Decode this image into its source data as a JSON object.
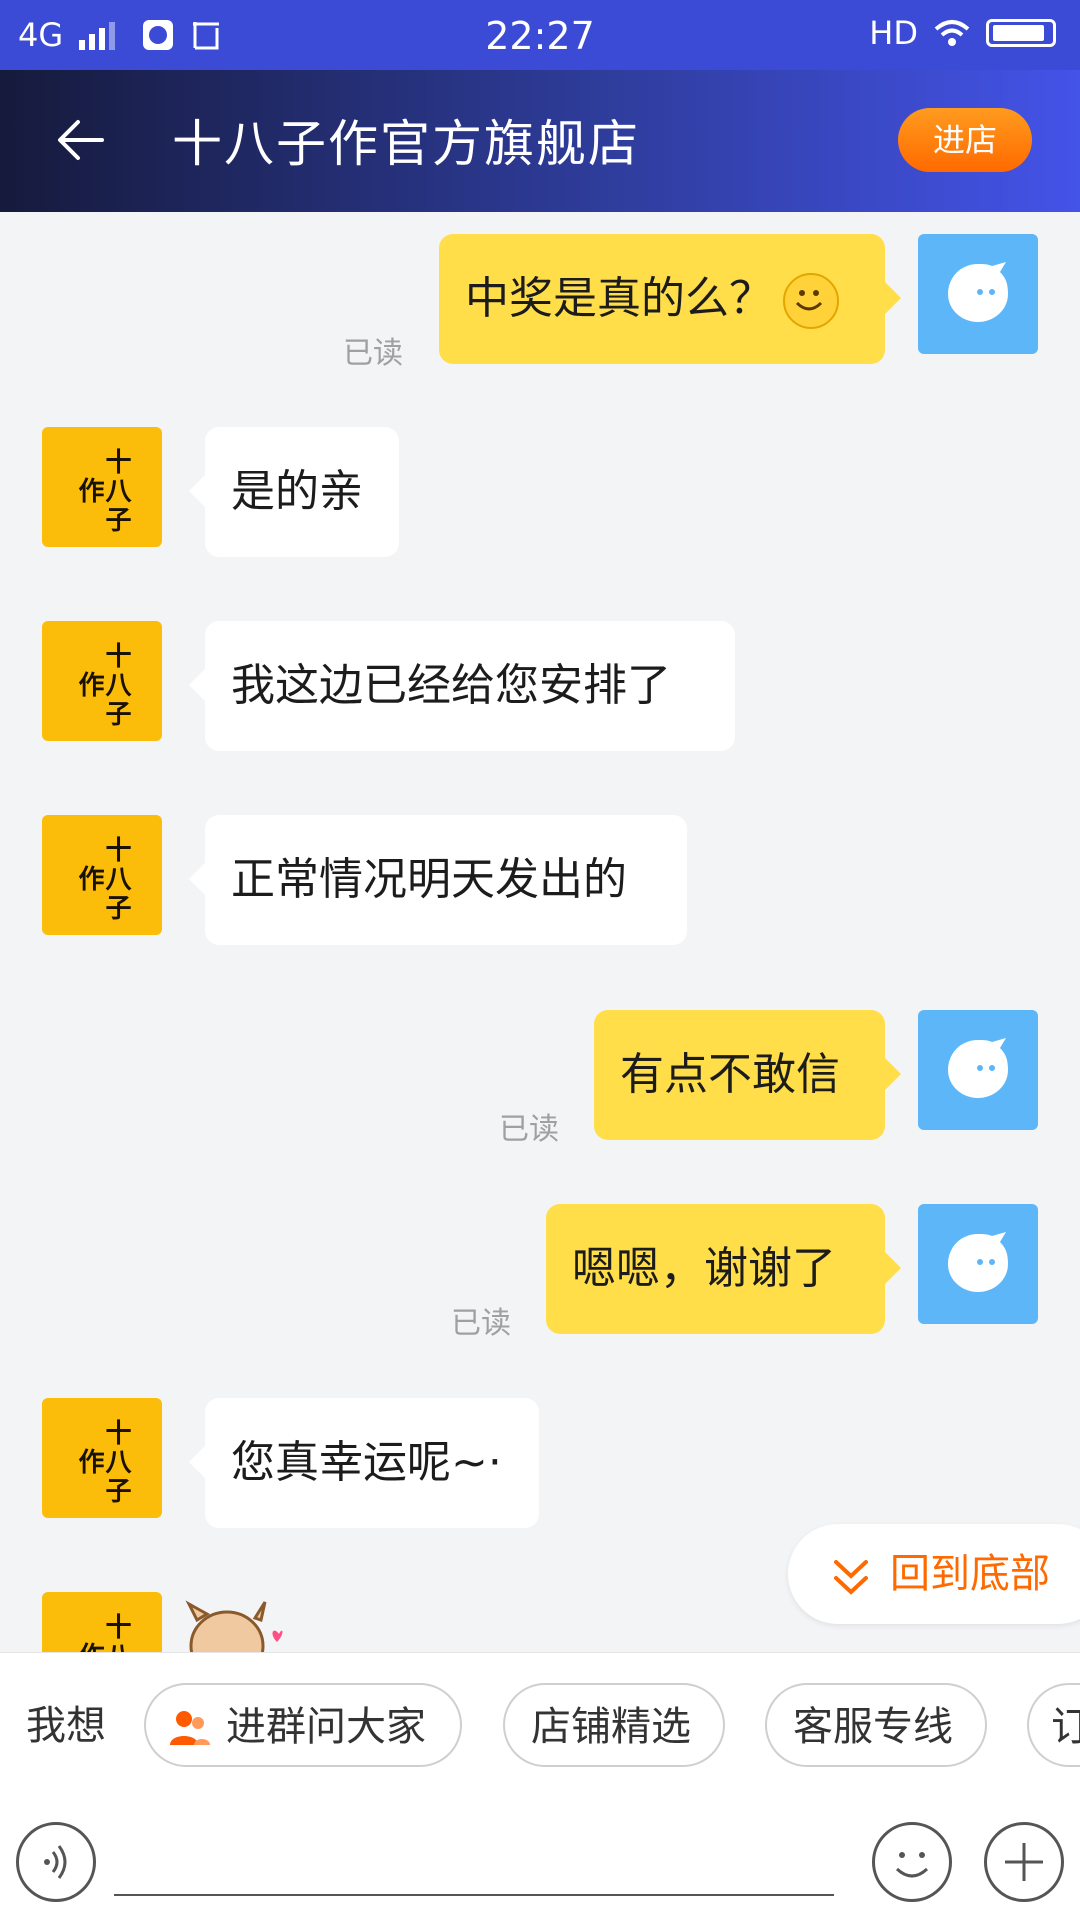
{
  "status_bar": {
    "network": "4G",
    "time": "22:27",
    "hd": "HD"
  },
  "header": {
    "title": "十八子作官方旗舰店",
    "enter_label": "进店"
  },
  "shop_logo_text": "十八子作",
  "messages": [
    {
      "side": "right",
      "text": "中奖是真的么？",
      "status": "已读"
    },
    {
      "side": "left",
      "text": "是的亲"
    },
    {
      "side": "left",
      "text": "我这边已经给您安排了"
    },
    {
      "side": "left",
      "text": "正常情况明天发出的"
    },
    {
      "side": "right",
      "text": "有点不敢信",
      "status": "已读"
    },
    {
      "side": "right",
      "text": "嗯嗯，谢谢了",
      "status": "已读"
    },
    {
      "side": "left",
      "text": "您真幸运呢~·"
    }
  ],
  "back_to_bottom": "回到底部",
  "quick_bar": {
    "label": "我想",
    "chips": [
      "进群问大家",
      "店铺精选",
      "客服专线",
      "订"
    ]
  },
  "colors": {
    "accent": "#ff6a00",
    "bubble_right": "#ffde4a",
    "avatar_shop": "#fbbd0a",
    "avatar_me": "#5cb6f8"
  }
}
